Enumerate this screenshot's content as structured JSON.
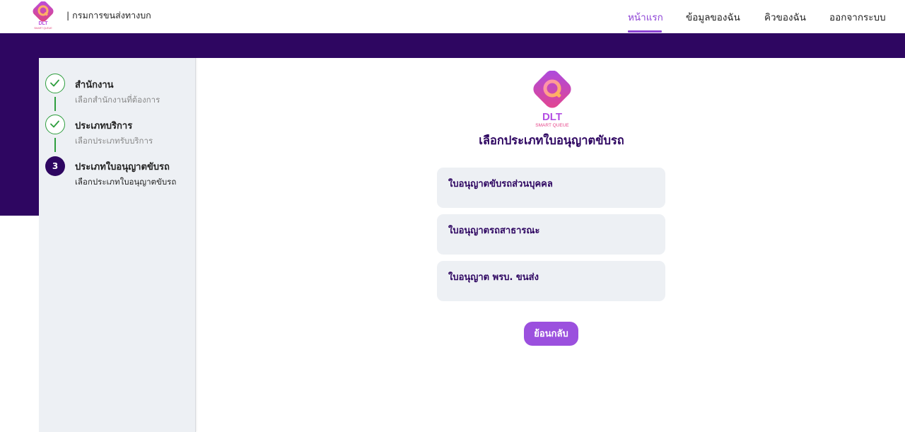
{
  "header": {
    "logo_icon": "dlt-smart-queue-logo",
    "org_name": "| กรมการขนส่งทางบก",
    "nav": [
      {
        "label": "หน้าแรก",
        "active": true
      },
      {
        "label": "ข้อมูลของฉัน",
        "active": false
      },
      {
        "label": "คิวของฉัน",
        "active": false
      },
      {
        "label": "ออกจากระบบ",
        "active": false
      }
    ]
  },
  "steps": [
    {
      "title": "สำนักงาน",
      "subtitle": "เลือกสำนักงานที่ต้องการ",
      "status": "done",
      "icon": "check-icon"
    },
    {
      "title": "ประเภทบริการ",
      "subtitle": "เลือกประเภทรับบริการ",
      "status": "done",
      "icon": "check-icon"
    },
    {
      "number": "3",
      "title": "ประเภทใบอนุญาตขับรถ",
      "subtitle": "เลือกประเภทใบอนุญาตขับรถ",
      "status": "current"
    }
  ],
  "main": {
    "logo_text": "DLT",
    "logo_subtext": "SMART QUEUE",
    "title": "เลือกประเภทใบอนุญาตขับรถ",
    "options": [
      {
        "label": "ใบอนุญาตขับรถส่วนบุคคล"
      },
      {
        "label": "ใบอนุญาตรถสาธารณะ"
      },
      {
        "label": "ใบอนุญาต พรบ. ขนส่ง"
      }
    ],
    "back_label": "ย้อนกลับ"
  },
  "colors": {
    "brand_dark": "#2e0661",
    "accent": "#9b50de",
    "active_nav": "#8e44d6",
    "step_done": "#2e9e3e",
    "card_bg": "#edf0f4"
  }
}
